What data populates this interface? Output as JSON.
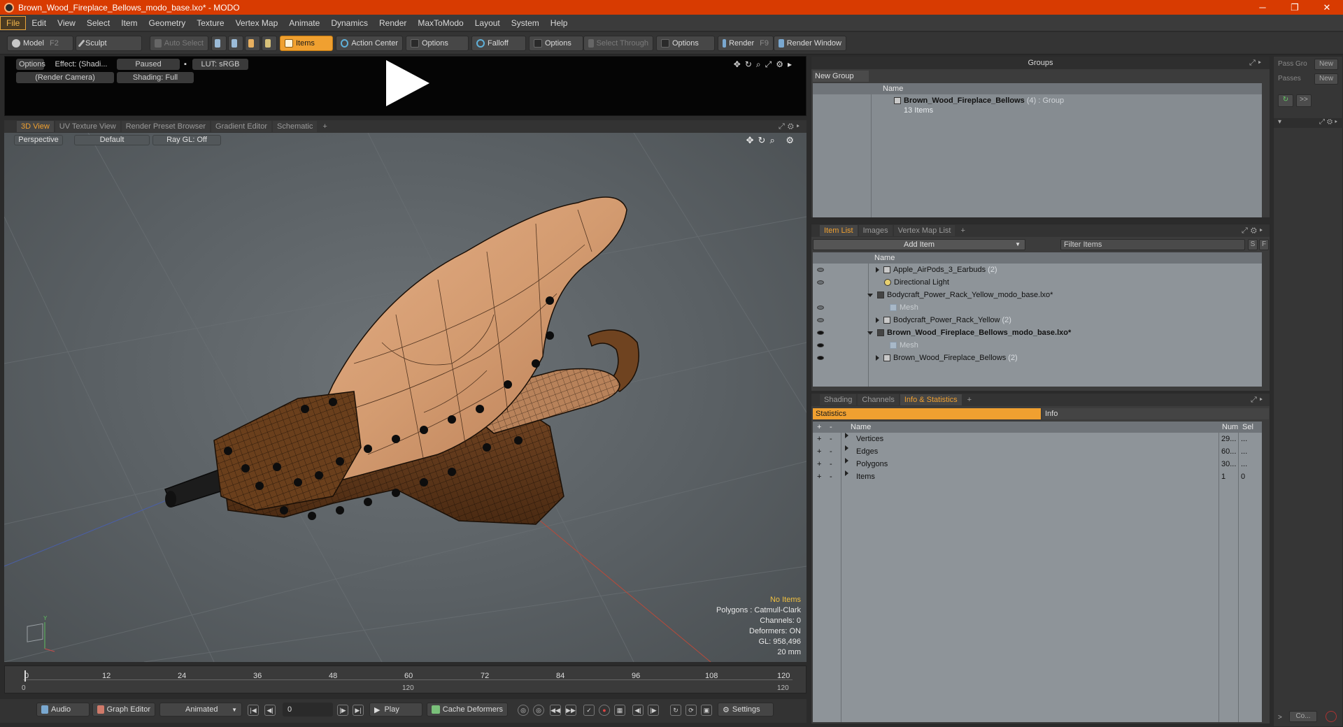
{
  "window": {
    "title": "Brown_Wood_Fireplace_Bellows_modo_base.lxo* - MODO",
    "minimize": "─",
    "restore": "❐",
    "close": "✕"
  },
  "menu": [
    "File",
    "Edit",
    "View",
    "Select",
    "Item",
    "Geometry",
    "Texture",
    "Vertex Map",
    "Animate",
    "Dynamics",
    "Render",
    "MaxToModo",
    "Layout",
    "System",
    "Help"
  ],
  "toolbar": {
    "model": "Model",
    "model_key": "F2",
    "sculpt": "Sculpt",
    "auto_select": "Auto Select",
    "items": "Items",
    "action_center": "Action Center",
    "options1": "Options",
    "falloff": "Falloff",
    "options2": "Options",
    "select_through": "Select Through",
    "options3": "Options",
    "render": "Render",
    "render_key": "F9",
    "render_window": "Render Window"
  },
  "preview": {
    "options": "Options",
    "effect": "Effect: (Shadi...",
    "paused": "Paused",
    "lut": "LUT: sRGB",
    "camera": "(Render Camera)",
    "shading": "Shading: Full"
  },
  "viewport_tabs": [
    "3D View",
    "UV Texture View",
    "Render Preset Browser",
    "Gradient Editor",
    "Schematic",
    "+"
  ],
  "viewport": {
    "perspective": "Perspective",
    "default": "Default",
    "raygl": "Ray GL: Off",
    "info": {
      "no_items": "No Items",
      "polygons": "Polygons : Catmull-Clark",
      "channels": "Channels: 0",
      "deformers": "Deformers: ON",
      "gl": "GL: 958,496",
      "size": "20 mm"
    }
  },
  "timeline": {
    "ticks": [
      "0",
      "12",
      "24",
      "36",
      "48",
      "60",
      "72",
      "84",
      "96",
      "108",
      "120"
    ],
    "range_start": "0",
    "range_mid": "120",
    "range_end": "120"
  },
  "transport": {
    "audio": "Audio",
    "graph_editor": "Graph Editor",
    "animated": "Animated",
    "frame": "0",
    "play": "Play",
    "cache_deformers": "Cache Deformers",
    "settings": "Settings"
  },
  "groups": {
    "title": "Groups",
    "new_group": "New Group",
    "col_name": "Name",
    "group_name": "Brown_Wood_Fireplace_Bellows",
    "group_count": "(4)",
    "group_type": ": Group",
    "group_items": "13 Items"
  },
  "pass": {
    "pass_gro": "Pass Gro",
    "new1": "New",
    "passes": "Passes",
    "new2": "New",
    "more": ">>",
    "co": "Co..."
  },
  "itemlist": {
    "tabs": [
      "Item List",
      "Images",
      "Vertex Map List",
      "+"
    ],
    "add_item": "Add Item",
    "filter": "Filter Items",
    "s": "S",
    "f": "F",
    "col_name": "Name",
    "rows": [
      {
        "label": "Apple_AirPods_3_Earbuds",
        "count": "(2)"
      },
      {
        "label": "Directional Light",
        "count": ""
      },
      {
        "label": "Bodycraft_Power_Rack_Yellow_modo_base.lxo*",
        "count": ""
      },
      {
        "label": "Mesh",
        "count": ""
      },
      {
        "label": "Bodycraft_Power_Rack_Yellow",
        "count": "(2)"
      },
      {
        "label": "Brown_Wood_Fireplace_Bellows_modo_base.lxo*",
        "count": ""
      },
      {
        "label": "Mesh",
        "count": ""
      },
      {
        "label": "Brown_Wood_Fireplace_Bellows",
        "count": "(2)"
      }
    ]
  },
  "stats": {
    "tabs": [
      "Shading",
      "Channels",
      "Info & Statistics",
      "+"
    ],
    "statistics": "Statistics",
    "info": "Info",
    "plus": "+",
    "minus": "-",
    "col_name": "Name",
    "col_num": "Num",
    "col_sel": "Sel",
    "rows": [
      {
        "name": "Vertices",
        "num": "29...",
        "sel": "..."
      },
      {
        "name": "Edges",
        "num": "60...",
        "sel": "..."
      },
      {
        "name": "Polygons",
        "num": "30...",
        "sel": "..."
      },
      {
        "name": "Items",
        "num": "1",
        "sel": "0"
      }
    ]
  },
  "colors": {
    "titlebar": "#d83b01",
    "accent": "#f0a030",
    "wood": "#c8875a"
  }
}
